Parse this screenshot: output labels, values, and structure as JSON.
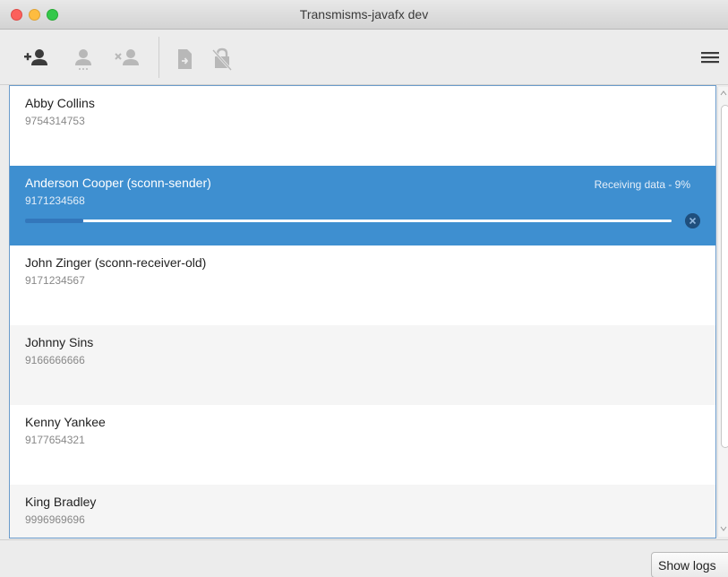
{
  "window": {
    "title": "Transmisms-javafx dev"
  },
  "toolbar": {
    "icons": [
      "add-contact-icon",
      "contact-options-icon",
      "remove-contact-icon",
      "file-send-icon",
      "lock-off-icon",
      "menu-icon"
    ]
  },
  "contacts": [
    {
      "name": "Abby Collins",
      "phone": "9754314753"
    },
    {
      "name": "Anderson Cooper (sconn-sender)",
      "phone": "9171234568",
      "status": "Receiving data - 9%",
      "progress": 0.09,
      "selected": true
    },
    {
      "name": "John Zinger (sconn-receiver-old)",
      "phone": "9171234567"
    },
    {
      "name": "Johnny Sins",
      "phone": "9166666666"
    },
    {
      "name": "Kenny Yankee",
      "phone": "9177654321"
    },
    {
      "name": "King Bradley",
      "phone": "9996969696"
    }
  ],
  "footer": {
    "show_logs_label": "Show logs"
  },
  "colors": {
    "selection": "#3e8fd0",
    "progress": "#3377bb",
    "border": "#6a9bcb"
  }
}
